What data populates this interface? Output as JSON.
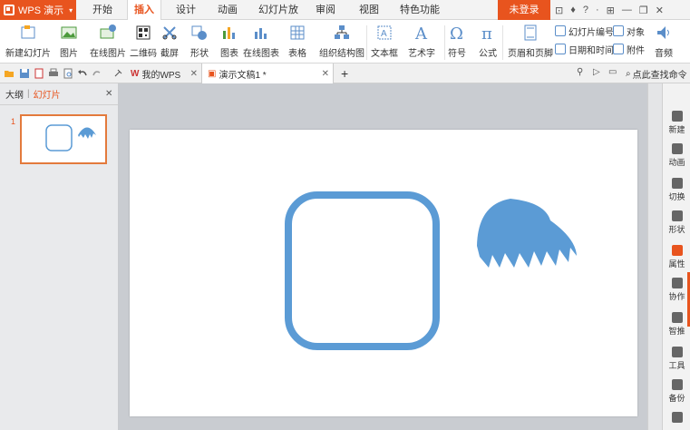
{
  "app": {
    "name": "WPS 演示",
    "login": "未登录"
  },
  "menu": {
    "tabs": [
      "开始",
      "插入",
      "设计",
      "动画",
      "幻灯片放映",
      "审阅",
      "视图",
      "特色功能"
    ],
    "active": "插入"
  },
  "ribbon": {
    "new_slide": "新建幻灯片",
    "picture": "图片",
    "online_picture": "在线图片",
    "qrcode": "二维码",
    "screenshot": "截屏",
    "shape": "形状",
    "chart": "图表",
    "online_chart": "在线图表",
    "table": "表格",
    "smartart": "组织结构图",
    "textbox": "文本框",
    "wordart": "艺术字",
    "symbol": "符号",
    "formula": "公式",
    "header_footer": "页眉和页脚",
    "slide_number": "幻灯片编号",
    "object": "对象",
    "date_time": "日期和时间",
    "attachment": "附件",
    "audio": "音频"
  },
  "doc_tabs": {
    "mywps": "我的WPS",
    "current": "演示文稿1 *",
    "new_tab": "+"
  },
  "find_command": "点此查找命令",
  "left_panel": {
    "outline": "大纲",
    "slides": "幻灯片",
    "slide_number": "1"
  },
  "right_bar": {
    "items": [
      "新建",
      "动画",
      "切换",
      "形状",
      "属性",
      "协作",
      "智推",
      "工具",
      "备份"
    ]
  },
  "colors": {
    "accent": "#e8541e",
    "shape_fill": "#5b9bd5",
    "shape_stroke": "#5b9bd5"
  }
}
